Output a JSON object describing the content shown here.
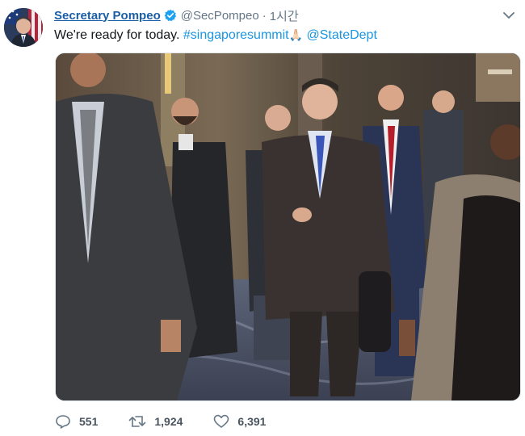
{
  "tweet": {
    "author": {
      "display_name": "Secretary Pompeo",
      "handle": "@SecPompeo",
      "separator": "·",
      "time": "1시간"
    },
    "text_parts": {
      "plain": "We're ready for today. ",
      "hashtag": "#singaporesummit",
      "emoji": "🙏🏻",
      "mention": "@StateDept"
    },
    "actions": {
      "replies": "551",
      "retweets": "1,924",
      "likes": "6,391"
    }
  },
  "icons": {
    "verified": "verified-badge-icon",
    "caret": "chevron-down-icon",
    "reply": "reply-icon",
    "retweet": "retweet-icon",
    "like": "heart-icon"
  },
  "colors": {
    "name_link": "#1b5ea8",
    "link": "#1b95e0",
    "muted": "#657786",
    "verified": "#1da1f2"
  }
}
